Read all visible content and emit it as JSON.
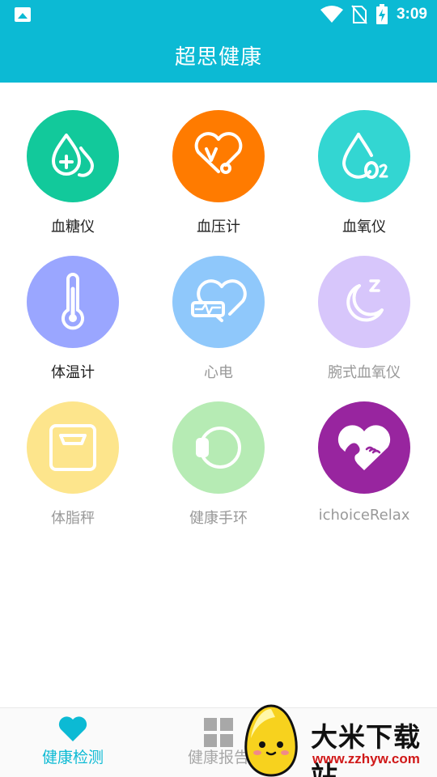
{
  "status_bar": {
    "time": "3:09",
    "icons": [
      "gallery-icon",
      "wifi-icon",
      "no-sim-icon",
      "battery-charging-icon"
    ]
  },
  "header": {
    "title": "超思健康"
  },
  "devices": [
    {
      "label": "血糖仪",
      "icon": "blood-glucose-icon",
      "color": "#12c99b",
      "enabled": true
    },
    {
      "label": "血压计",
      "icon": "blood-pressure-icon",
      "color": "#ff7b00",
      "enabled": true
    },
    {
      "label": "血氧仪",
      "icon": "blood-oxygen-icon",
      "color": "#33d6d2",
      "enabled": true
    },
    {
      "label": "体温计",
      "icon": "thermometer-icon",
      "color": "#9aa6ff",
      "enabled": true
    },
    {
      "label": "心电",
      "icon": "ecg-heart-icon",
      "color": "#8fc8fb",
      "enabled": false
    },
    {
      "label": "腕式血氧仪",
      "icon": "moon-sleep-icon",
      "color": "#d7c6fb",
      "enabled": false
    },
    {
      "label": "体脂秤",
      "icon": "scale-icon",
      "color": "#fde58c",
      "enabled": false
    },
    {
      "label": "健康手环",
      "icon": "band-icon",
      "color": "#b6ebb4",
      "enabled": false
    },
    {
      "label": "ichoiceRelax",
      "icon": "relax-heart-icon",
      "color": "#98259f",
      "enabled": false
    }
  ],
  "bottom_nav": {
    "items": [
      {
        "label": "健康检测",
        "icon": "heart-icon",
        "active": true,
        "color": "#0cbad4"
      },
      {
        "label": "健康报告",
        "icon": "grid-icon",
        "active": false,
        "color": "#a8a8a8"
      }
    ]
  },
  "watermark": {
    "title": "大米下载站",
    "url": "www.zzhyw.com"
  }
}
